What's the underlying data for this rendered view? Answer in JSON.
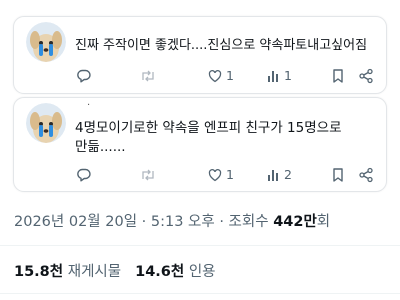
{
  "replies": [
    {
      "text": "진짜 주작이면 좋겠다....진심으로 약속파토내고싶어짐",
      "like_count": "1",
      "view_count": "1"
    },
    {
      "text": "4명모이기로한 약속을 엔프피 친구가 15명으로 만듦......",
      "like_count": "1",
      "view_count": "2"
    }
  ],
  "post_meta": {
    "datetime": "2026년 02월 20일 · 5:13 오후 · 조회수 ",
    "views_number": "442만",
    "views_suffix": "회"
  },
  "engagement": {
    "reposts_number": "15.8천",
    "reposts_label": "재게시물",
    "quotes_number": "14.6천",
    "quotes_label": "인용"
  },
  "colors": {
    "text": "#0f1419",
    "secondary": "#536471",
    "card_border": "#e3e6e9",
    "divider": "#eff3f4"
  }
}
